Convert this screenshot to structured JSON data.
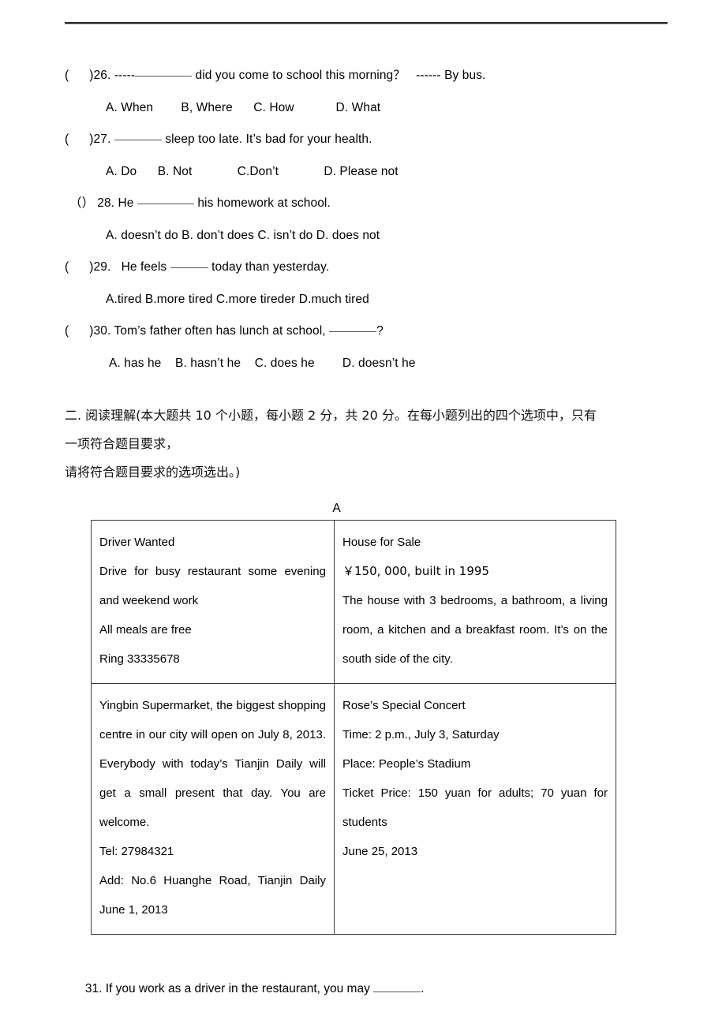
{
  "document": {
    "type": "exam-paper-page",
    "header_rule": true
  },
  "multiple_choice": {
    "questions": [
      {
        "marker_open": "(",
        "marker_close": ")",
        "number": "26.",
        "stem_before": " -----",
        "stem_after": " did you come to school this morning？   ------ By bus.",
        "options": "A. When        B, Where      C. How            D. What"
      },
      {
        "marker_open": "(",
        "marker_close": ")",
        "number": "27.",
        "stem_before": " ",
        "stem_after": " sleep too late. It’s bad for your health.",
        "options": "A. Do      B. Not             C.Don’t             D. Please not"
      },
      {
        "marker_open": "（",
        "marker_close": "）",
        "number": "28.",
        "stem_before": " He ",
        "stem_after": " his homework at school.",
        "options": "A. doesn’t do B. don’t does C. isn’t do D. does not"
      },
      {
        "marker_open": "(",
        "marker_close": ")",
        "number": "29.",
        "stem_before": "   He feels ",
        "stem_after": " today than yesterday.",
        "options": "A.tired B.more tired C.more tireder D.much tired"
      },
      {
        "marker_open": "(",
        "marker_close": ")",
        "number": "30.",
        "stem_before": " Tom’s father often has lunch at school, ",
        "stem_after": "?",
        "options": "A. has he    B. hasn’t he    C. does he        D. doesn’t he"
      }
    ]
  },
  "reading_section": {
    "line1": "二. 阅读理解(本大题共 10 个小题，每小题 2 分，共 20 分。在每小题列出的四个选项中，只有",
    "line2": "一项符合题目要求，",
    "line3": "请将符合题目要求的选项选出。)",
    "passage_label": "A"
  },
  "ads_table": {
    "cells": {
      "driver_wanted": [
        "Driver Wanted",
        "Drive for busy restaurant some evening and weekend work",
        "All meals are free",
        "Ring 33335678"
      ],
      "house_for_sale": [
        "House for Sale",
        "￥150, 000, built in 1995",
        "The house with 3 bedrooms, a bathroom, a living room, a kitchen and a breakfast room. It’s on the south side of the city."
      ],
      "supermarket": [
        "Yingbin Supermarket, the biggest shopping centre in our city will open on July 8, 2013. Everybody with today’s Tianjin Daily will get a small present that day. You are welcome.",
        "Tel: 27984321",
        "Add: No.6 Huanghe Road, Tianjin Daily June 1, 2013"
      ],
      "concert": [
        "Rose’s Special Concert",
        "Time: 2 p.m., July 3, Saturday",
        "Place: People’s Stadium",
        "Ticket Price: 150 yuan for adults; 70 yuan for students",
        "June 25, 2013"
      ]
    }
  },
  "question_31": {
    "before": "31. If you work as a driver in the restaurant, you may ",
    "after": "."
  }
}
